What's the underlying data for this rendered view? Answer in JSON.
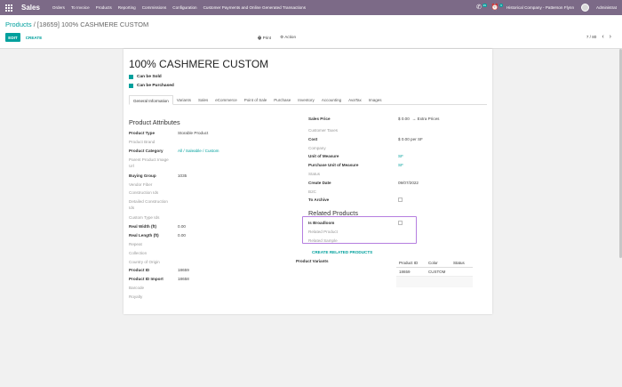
{
  "navbar": {
    "brand": "Sales",
    "menu": [
      "Orders",
      "To Invoice",
      "Products",
      "Reporting",
      "Commissions",
      "Configuration",
      "Customer Payments and Online Generated Transactions"
    ],
    "chat_badge": "29",
    "activity_badge": "6",
    "company": "Historical Company - Patterson Flynn",
    "user": "Administrat"
  },
  "control_panel": {
    "breadcrumb_root": "Products",
    "breadcrumb_sep": "/",
    "breadcrumb_current": "[18659] 100% CASHMERE CUSTOM",
    "edit_label": "EDIT",
    "create_label": "CREATE",
    "print_label": "Print",
    "action_label": "Action",
    "pager": "7 / 80"
  },
  "product": {
    "name": "100% CASHMERE CUSTOM",
    "can_be_sold_label": "Can be Sold",
    "can_be_purchased_label": "Can be Purchased"
  },
  "tabs": [
    "General Information",
    "Variants",
    "Sales",
    "eCommerce",
    "Point of Sale",
    "Purchase",
    "Inventory",
    "Accounting",
    "AvaTax",
    "Images"
  ],
  "left": {
    "group_title": "Product Attributes",
    "fields": [
      {
        "label": "Product Type",
        "value": "Storable Product",
        "bold": true
      },
      {
        "label": "Product Brand",
        "value": "",
        "bold": false
      },
      {
        "label": "Product Category",
        "value": "All / Saleable / Custom",
        "bold": true,
        "link": true
      },
      {
        "label": "Parent Product Image Url",
        "value": "",
        "bold": false
      },
      {
        "label": "Buying Group",
        "value": "1035",
        "bold": true
      },
      {
        "label": "Vendor Fiber",
        "value": "",
        "bold": false
      },
      {
        "label": "Construction Ids",
        "value": "",
        "bold": false
      },
      {
        "label": "Detailed Construction Ids",
        "value": "",
        "bold": false
      },
      {
        "label": "Custom Type Ids",
        "value": "",
        "bold": false
      },
      {
        "label": "Real Width (ft)",
        "value": "0.00",
        "bold": true
      },
      {
        "label": "Real Length (ft)",
        "value": "0.00",
        "bold": true
      },
      {
        "label": "Repeat",
        "value": "",
        "bold": false
      },
      {
        "label": "Collection",
        "value": "",
        "bold": false
      },
      {
        "label": "Country of Origin",
        "value": "",
        "bold": false
      },
      {
        "label": "Product ID",
        "value": "18659",
        "bold": true
      },
      {
        "label": "Product ID Import",
        "value": "18658",
        "bold": true
      },
      {
        "label": "Barcode",
        "value": "",
        "bold": false
      },
      {
        "label": "Royalty",
        "value": "",
        "bold": false
      }
    ]
  },
  "right": {
    "sales_price_label": "Sales Price",
    "sales_price_value": "$ 0.00",
    "extra_prices_label": "Extra Prices",
    "fields": [
      {
        "label": "Customer Taxes",
        "value": "",
        "bold": false
      },
      {
        "label": "Cost",
        "value": "$ 0.00 per SF",
        "bold": true
      },
      {
        "label": "Company",
        "value": "",
        "bold": false
      },
      {
        "label": "Unit of Measure",
        "value": "SF",
        "bold": true,
        "link": true
      },
      {
        "label": "Purchase Unit of Measure",
        "value": "SF",
        "bold": true,
        "link": true
      },
      {
        "label": "Status",
        "value": "",
        "bold": false
      },
      {
        "label": "Create Date",
        "value": "09/07/2022",
        "bold": true
      },
      {
        "label": "B2C",
        "value": "",
        "bold": false
      },
      {
        "label": "To Archive",
        "value": "",
        "bold": true,
        "checkbox": true
      }
    ],
    "related_title": "Related Products",
    "is_broadloom_label": "Is Broadloom",
    "related_product_label": "Related Product",
    "related_sample_label": "Related Sample",
    "create_related_label": "CREATE RELATED PRODUCTS",
    "variants_label": "Product Variants",
    "variants_table": {
      "headers": [
        "Product ID",
        "Color",
        "Status"
      ],
      "rows": [
        [
          "18659",
          "CUSTOM",
          ""
        ]
      ]
    }
  }
}
